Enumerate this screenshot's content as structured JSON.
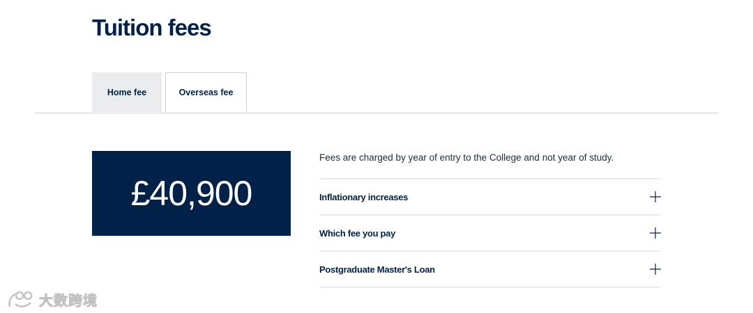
{
  "page": {
    "title": "Tuition fees"
  },
  "tabs": [
    {
      "label": "Home fee",
      "active": false
    },
    {
      "label": "Overseas fee",
      "active": true
    }
  ],
  "fee": {
    "amount": "£40,900"
  },
  "fees_note": "Fees are charged by year of entry to the College and not year of study.",
  "accordion": [
    {
      "label": "Inflationary increases",
      "icon": "plus-icon"
    },
    {
      "label": "Which fee you pay",
      "icon": "plus-icon"
    },
    {
      "label": "Postgraduate Master's Loan",
      "icon": "plus-icon"
    }
  ],
  "watermark": {
    "text": "大数跨境"
  },
  "colors": {
    "brand_navy": "#002147",
    "inactive_tab_bg": "#ebeced",
    "divider": "#ececec"
  }
}
